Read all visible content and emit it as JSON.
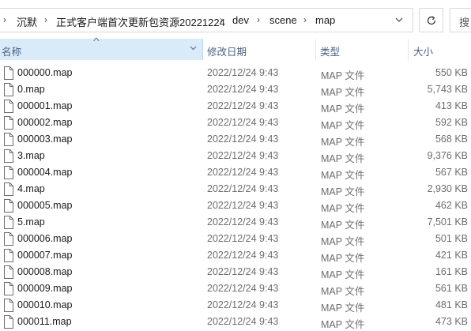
{
  "address_bar": {
    "breadcrumbs": [
      "沉默",
      "正式客户端首次更新包资源20221224",
      "dev",
      "scene",
      "map"
    ],
    "separator": "›"
  },
  "search": {
    "placeholder": "搜"
  },
  "columns": {
    "name": "名称",
    "date": "修改日期",
    "type": "类型",
    "size": "大小"
  },
  "files": [
    {
      "name": "000000.map",
      "date": "2022/12/24 9:43",
      "type": "MAP 文件",
      "size": "550 KB"
    },
    {
      "name": "0.map",
      "date": "2022/12/24 9:43",
      "type": "MAP 文件",
      "size": "5,743 KB"
    },
    {
      "name": "000001.map",
      "date": "2022/12/24 9:43",
      "type": "MAP 文件",
      "size": "413 KB"
    },
    {
      "name": "000002.map",
      "date": "2022/12/24 9:43",
      "type": "MAP 文件",
      "size": "592 KB"
    },
    {
      "name": "000003.map",
      "date": "2022/12/24 9:43",
      "type": "MAP 文件",
      "size": "568 KB"
    },
    {
      "name": "3.map",
      "date": "2022/12/24 9:43",
      "type": "MAP 文件",
      "size": "9,376 KB"
    },
    {
      "name": "000004.map",
      "date": "2022/12/24 9:43",
      "type": "MAP 文件",
      "size": "567 KB"
    },
    {
      "name": "4.map",
      "date": "2022/12/24 9:43",
      "type": "MAP 文件",
      "size": "2,930 KB"
    },
    {
      "name": "000005.map",
      "date": "2022/12/24 9:43",
      "type": "MAP 文件",
      "size": "462 KB"
    },
    {
      "name": "5.map",
      "date": "2022/12/24 9:43",
      "type": "MAP 文件",
      "size": "7,501 KB"
    },
    {
      "name": "000006.map",
      "date": "2022/12/24 9:43",
      "type": "MAP 文件",
      "size": "501 KB"
    },
    {
      "name": "000007.map",
      "date": "2022/12/24 9:43",
      "type": "MAP 文件",
      "size": "421 KB"
    },
    {
      "name": "000008.map",
      "date": "2022/12/24 9:43",
      "type": "MAP 文件",
      "size": "161 KB"
    },
    {
      "name": "000009.map",
      "date": "2022/12/24 9:43",
      "type": "MAP 文件",
      "size": "561 KB"
    },
    {
      "name": "000010.map",
      "date": "2022/12/24 9:43",
      "type": "MAP 文件",
      "size": "481 KB"
    },
    {
      "name": "000011.map",
      "date": "2022/12/24 9:43",
      "type": "MAP 文件",
      "size": "473 KB"
    }
  ],
  "icons": {
    "file": "file-icon",
    "refresh": "refresh-icon",
    "dropdown": "chevron-down-icon",
    "sort": "sort-ascending-icon"
  },
  "colors": {
    "header_selected": "#d9ebf9",
    "header_text": "#4d6082",
    "secondary_text": "#6d6d6d"
  }
}
